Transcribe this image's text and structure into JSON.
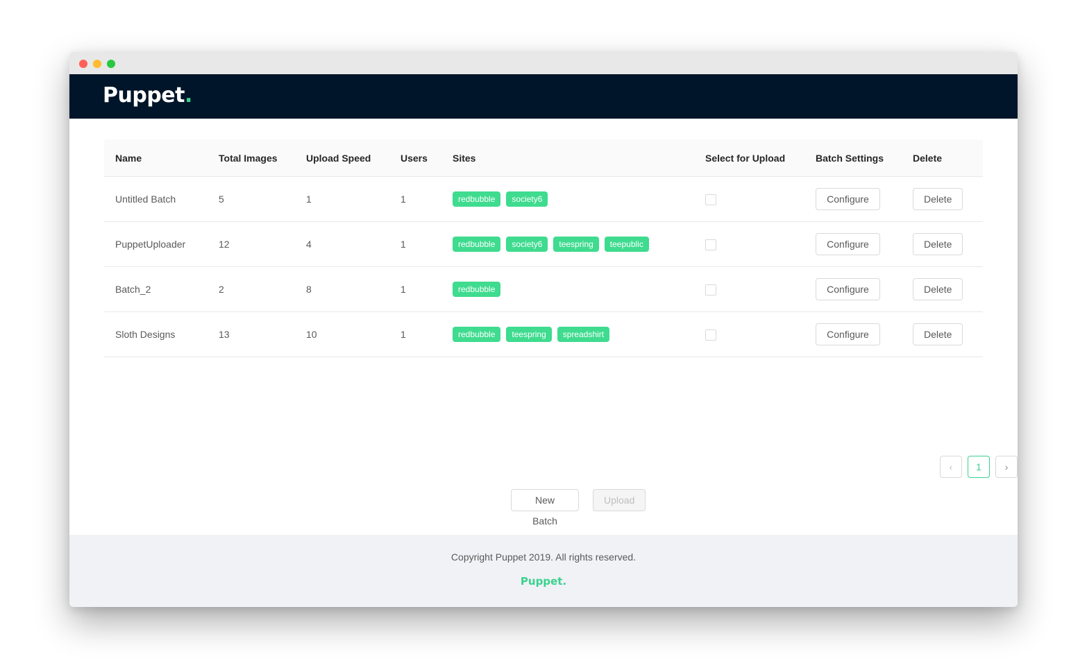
{
  "app": {
    "logo_text": "Puppet",
    "logo_dot": ".",
    "accent_color": "#3bd18f",
    "header_color": "#001529"
  },
  "table": {
    "columns": [
      "Name",
      "Total Images",
      "Upload Speed",
      "Users",
      "Sites",
      "Select for Upload",
      "Batch Settings",
      "Delete"
    ],
    "rows": [
      {
        "name": "Untitled Batch",
        "total_images": "5",
        "upload_speed": "1",
        "users": "1",
        "sites": [
          "redbubble",
          "society6"
        ],
        "selected": false,
        "configure_label": "Configure",
        "delete_label": "Delete"
      },
      {
        "name": "PuppetUploader",
        "total_images": "12",
        "upload_speed": "4",
        "users": "1",
        "sites": [
          "redbubble",
          "society6",
          "teespring",
          "teepublic"
        ],
        "selected": false,
        "configure_label": "Configure",
        "delete_label": "Delete"
      },
      {
        "name": "Batch_2",
        "total_images": "2",
        "upload_speed": "8",
        "users": "1",
        "sites": [
          "redbubble"
        ],
        "selected": false,
        "configure_label": "Configure",
        "delete_label": "Delete"
      },
      {
        "name": "Sloth Designs",
        "total_images": "13",
        "upload_speed": "10",
        "users": "1",
        "sites": [
          "redbubble",
          "teespring",
          "spreadshirt"
        ],
        "selected": false,
        "configure_label": "Configure",
        "delete_label": "Delete"
      }
    ]
  },
  "pagination": {
    "prev_icon": "chevron-left-icon",
    "prev_glyph": "‹",
    "current_page": "1",
    "next_icon": "chevron-right-icon",
    "next_glyph": "›"
  },
  "actions": {
    "new_batch_label": "New Batch",
    "upload_label": "Upload"
  },
  "footer": {
    "copyright": "Copyright Puppet 2019. All rights reserved.",
    "logo_text": "Puppet."
  }
}
